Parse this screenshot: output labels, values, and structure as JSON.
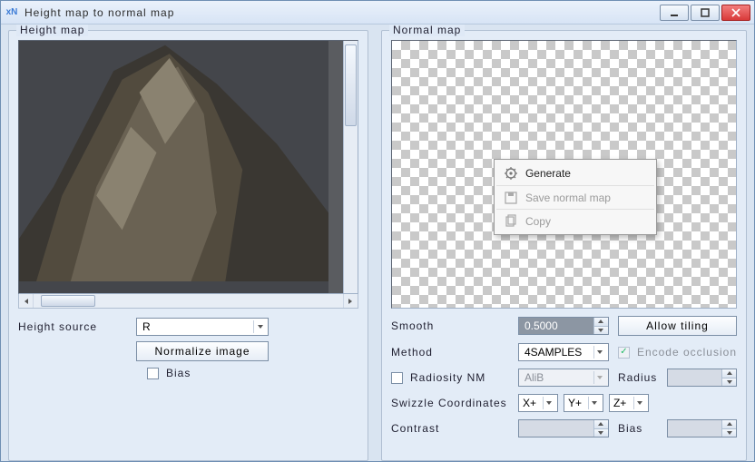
{
  "window": {
    "app_icon_text": "xN",
    "title": "Height map to normal map"
  },
  "left": {
    "group_title": "Height map",
    "height_source_label": "Height source",
    "height_source_value": "R",
    "normalize_button": "Normalize image",
    "bias_label": "Bias",
    "bias_checked": false
  },
  "right": {
    "group_title": "Normal map",
    "context_menu": {
      "generate": "Generate",
      "save": "Save normal map",
      "copy": "Copy"
    },
    "smooth_label": "Smooth",
    "smooth_value": "0.5000",
    "allow_tiling_button": "Allow tiling",
    "method_label": "Method",
    "method_value": "4SAMPLES",
    "encode_occlusion_label": "Encode occlusion",
    "encode_occlusion_checked": true,
    "radiosity_label": "Radiosity NM",
    "radiosity_checked": false,
    "radiosity_preset_value": "AliB",
    "radius_label": "Radius",
    "radius_value": "",
    "swizzle_label": "Swizzle Coordinates",
    "swizzle_x": "X+",
    "swizzle_y": "Y+",
    "swizzle_z": "Z+",
    "contrast_label": "Contrast",
    "contrast_value": "",
    "bias2_label": "Bias",
    "bias2_value": ""
  }
}
